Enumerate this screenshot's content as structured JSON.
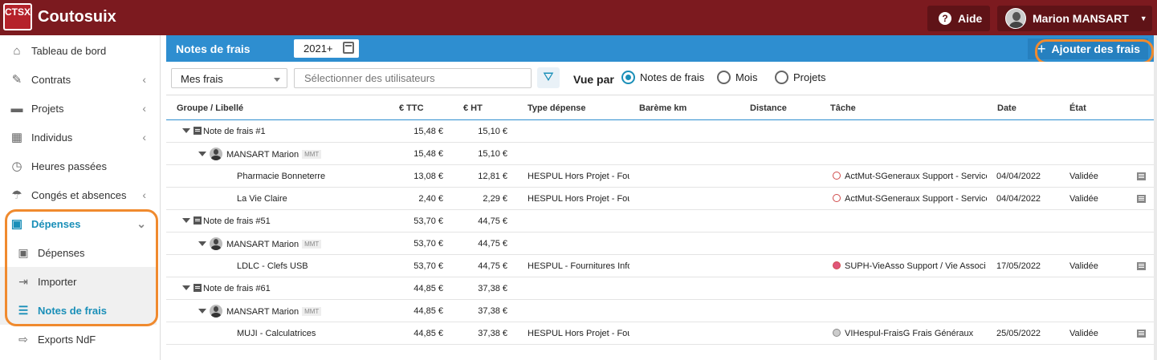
{
  "app": {
    "logo_text": "CTSX",
    "title": "Coutosuix"
  },
  "header": {
    "help_label": "Aide",
    "user_name": "Marion MANSART"
  },
  "sidebar": {
    "items": [
      {
        "label": "Tableau de bord",
        "icon": "home-icon"
      },
      {
        "label": "Contrats",
        "icon": "contract-icon"
      },
      {
        "label": "Projets",
        "icon": "folder-icon"
      },
      {
        "label": "Individus",
        "icon": "calendar-icon"
      },
      {
        "label": "Heures passées",
        "icon": "clock-icon"
      },
      {
        "label": "Congés et absences",
        "icon": "beach-icon"
      },
      {
        "label": "Dépenses",
        "icon": "money-icon"
      }
    ],
    "subitems": [
      {
        "label": "Dépenses",
        "icon": "money-icon"
      },
      {
        "label": "Importer",
        "icon": "import-icon"
      },
      {
        "label": "Notes de frais",
        "icon": "list-icon"
      },
      {
        "label": "Exports NdF",
        "icon": "export-icon"
      }
    ]
  },
  "main": {
    "title": "Notes de frais",
    "year": "2021+",
    "add_button": "Ajouter des frais",
    "filters": {
      "select_value": "Mes frais",
      "users_placeholder": "Sélectionner des utilisateurs",
      "vue_par_label": "Vue par",
      "radio_options": [
        "Notes de frais",
        "Mois",
        "Projets"
      ],
      "selected_radio": "Notes de frais"
    },
    "columns": [
      "Groupe / Libellé",
      "€ TTC",
      "€ HT",
      "Type dépense",
      "Barème km",
      "Distance",
      "Tâche",
      "Date",
      "État"
    ],
    "rows": [
      {
        "kind": "group",
        "label": "Note de frais #1",
        "ttc": "15,48 €",
        "ht": "15,10 €"
      },
      {
        "kind": "person",
        "label": "MANSART Marion",
        "badge": "MMT",
        "ttc": "15,48 €",
        "ht": "15,10 €"
      },
      {
        "kind": "item",
        "label": "Pharmacie Bonneterre",
        "ttc": "13,08 €",
        "ht": "12,81 €",
        "type": "HESPUL Hors Projet - Fou",
        "task": "ActMut-SGeneraux Support - Service",
        "task_color": "#ffffff",
        "date": "04/04/2022",
        "state": "Validée"
      },
      {
        "kind": "item",
        "label": "La Vie Claire",
        "ttc": "2,40 €",
        "ht": "2,29 €",
        "type": "HESPUL Hors Projet - Fou",
        "task": "ActMut-SGeneraux Support - Service",
        "task_color": "#ffffff",
        "date": "04/04/2022",
        "state": "Validée"
      },
      {
        "kind": "group",
        "label": "Note de frais #51",
        "ttc": "53,70 €",
        "ht": "44,75 €"
      },
      {
        "kind": "person",
        "label": "MANSART Marion",
        "badge": "MMT",
        "ttc": "53,70 €",
        "ht": "44,75 €"
      },
      {
        "kind": "item",
        "label": "LDLC - Clefs USB",
        "ttc": "53,70 €",
        "ht": "44,75 €",
        "type": "HESPUL - Fournitures Info",
        "task": "SUPH-VieAsso Support / Vie Associ",
        "task_color": "#e0557a",
        "date": "17/05/2022",
        "state": "Validée"
      },
      {
        "kind": "group",
        "label": "Note de frais #61",
        "ttc": "44,85 €",
        "ht": "37,38 €"
      },
      {
        "kind": "person",
        "label": "MANSART Marion",
        "badge": "MMT",
        "ttc": "44,85 €",
        "ht": "37,38 €"
      },
      {
        "kind": "item",
        "label": "MUJI - Calculatrices",
        "ttc": "44,85 €",
        "ht": "37,38 €",
        "type": "HESPUL Hors Projet - Fou",
        "task": "VIHespul-FraisG Frais Généraux",
        "task_color": "#cccccc",
        "date": "25/05/2022",
        "state": "Validée"
      }
    ]
  },
  "colors": {
    "topbar": "#7c1a1f",
    "blue_bar": "#2e8ed0",
    "accent": "#1a8fb8",
    "highlight": "#f08a2e"
  }
}
